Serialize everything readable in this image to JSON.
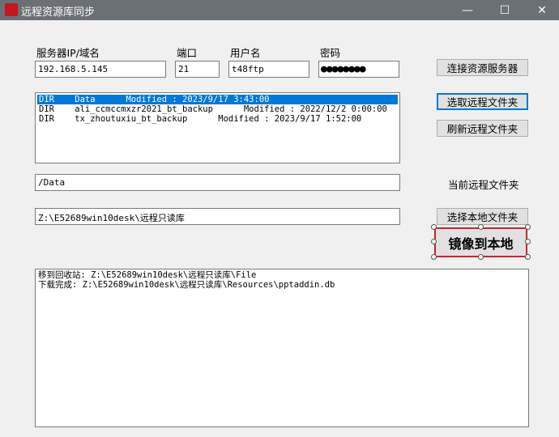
{
  "window": {
    "title": "远程资源库同步",
    "minimize": "—",
    "maximize": "☐",
    "close": "✕"
  },
  "labels": {
    "server": "服务器IP/域名",
    "port": "端口",
    "username": "用户名",
    "password": "密码",
    "current_remote_folder": "当前远程文件夹"
  },
  "inputs": {
    "server": "192.168.5.145",
    "port": "21",
    "username": "t48ftp",
    "password_mask": "●●●●●●●●",
    "remote_path": "/Data",
    "local_path": "Z:\\E52689win10desk\\远程只读库"
  },
  "buttons": {
    "connect": "连接资源服务器",
    "select_remote": "选取远程文件夹",
    "refresh_remote": "刷新远程文件夹",
    "select_local": "选择本地文件夹",
    "mirror": "镜像到本地"
  },
  "remote_list": [
    "DIR    Data      Modified : 2023/9/17 3:43:00",
    "DIR    ali_ccmccmxzr2021_bt_backup      Modified : 2022/12/2 0:00:00",
    "DIR    tx_zhoutuxiu_bt_backup      Modified : 2023/9/17 1:52:00"
  ],
  "log": [
    "移到回收站: Z:\\E52689win10desk\\远程只读库\\File",
    "下载完成: Z:\\E52689win10desk\\远程只读库\\Resources\\pptaddin.db"
  ]
}
